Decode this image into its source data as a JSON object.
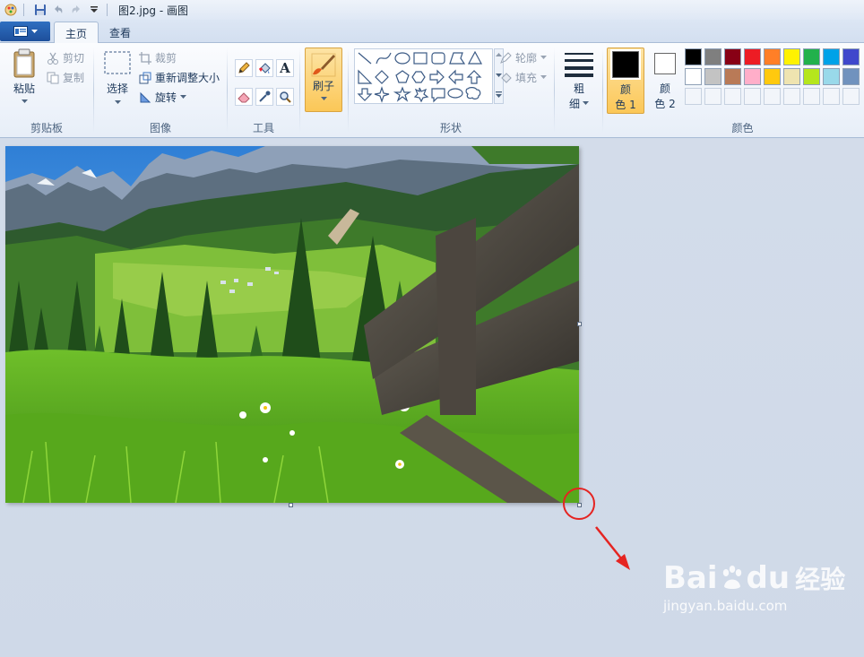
{
  "title_bar": {
    "title": "图2.jpg - 画图"
  },
  "tabs": [
    {
      "label": "主页",
      "active": true
    },
    {
      "label": "查看",
      "active": false
    }
  ],
  "ribbon": {
    "clipboard": {
      "paste": "粘贴",
      "cut": "剪切",
      "copy": "复制",
      "group": "剪贴板"
    },
    "image": {
      "select": "选择",
      "crop": "裁剪",
      "resize": "重新调整大小",
      "rotate": "旋转",
      "group": "图像"
    },
    "tools": {
      "group": "工具",
      "text_glyph": "A"
    },
    "brushes": {
      "label": "刷子"
    },
    "shapes": {
      "outline": "轮廓",
      "fill": "填充",
      "group": "形状"
    },
    "size": {
      "label_line1": "粗",
      "label_line2": "细"
    },
    "colors": {
      "color1_line1": "颜",
      "color1_line2": "色 1",
      "color2_line1": "颜",
      "color2_line2": "色 2",
      "group": "颜色",
      "palette_row1": [
        "#000000",
        "#7f7f7f",
        "#880015",
        "#ed1c24",
        "#ff7f27",
        "#fff200",
        "#22b14c",
        "#00a2e8",
        "#3f48cc"
      ],
      "palette_row2": [
        "#ffffff",
        "#c3c3c3",
        "#b97a57",
        "#ffaec9",
        "#ffc90e",
        "#efe4b0",
        "#b5e61d",
        "#99d9ea",
        "#7092be"
      ]
    }
  },
  "watermark": {
    "brand": "Bai",
    "brand2": "du",
    "cn": "经验",
    "url": "jingyan.baidu.com"
  }
}
